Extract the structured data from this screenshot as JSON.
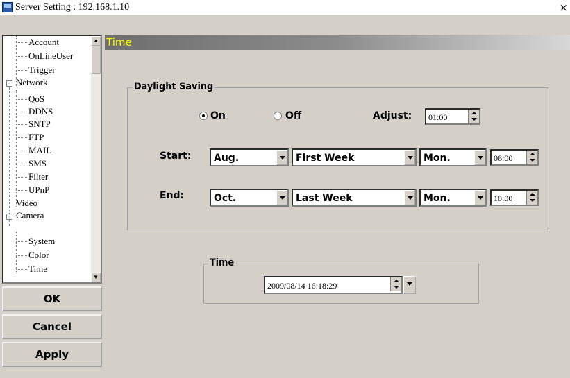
{
  "window": {
    "title": "Server Setting : 192.168.1.10",
    "close_glyph": "×"
  },
  "tree": {
    "items": [
      {
        "label": "Account",
        "level": 2
      },
      {
        "label": "OnLineUser",
        "level": 2
      },
      {
        "label": "Trigger",
        "level": 2
      },
      {
        "label": "Network",
        "level": 1,
        "expander": "-"
      },
      {
        "label": "QoS",
        "level": 2
      },
      {
        "label": "DDNS",
        "level": 2
      },
      {
        "label": "SNTP",
        "level": 2
      },
      {
        "label": "FTP",
        "level": 2
      },
      {
        "label": "MAIL",
        "level": 2
      },
      {
        "label": "SMS",
        "level": 2
      },
      {
        "label": "Filter",
        "level": 2
      },
      {
        "label": "UPnP",
        "level": 2
      },
      {
        "label": "Video",
        "level": 1
      },
      {
        "label": "Camera",
        "level": 1,
        "expander": "-"
      },
      {
        "label": "System",
        "level": 2
      },
      {
        "label": "Color",
        "level": 2
      },
      {
        "label": "Time",
        "level": 2
      }
    ]
  },
  "buttons": {
    "ok": "OK",
    "cancel": "Cancel",
    "apply": "Apply"
  },
  "header": {
    "title": "Time"
  },
  "daylight": {
    "group_title": "Daylight Saving",
    "on_label": "On",
    "off_label": "Off",
    "selected": "On",
    "adjust_label": "Adjust:",
    "adjust_value": "01:00",
    "start_label": "Start:",
    "start_month": "Aug.",
    "start_week": "First Week",
    "start_day": "Mon.",
    "start_time": "06:00",
    "end_label": "End:",
    "end_month": "Oct.",
    "end_week": "Last Week",
    "end_day": "Mon.",
    "end_time": "10:00"
  },
  "time": {
    "group_title": "Time",
    "datetime": "2009/08/14 16:18:29"
  },
  "colors": {
    "header_text": "#ffff00",
    "face": "#d4d0c8"
  }
}
